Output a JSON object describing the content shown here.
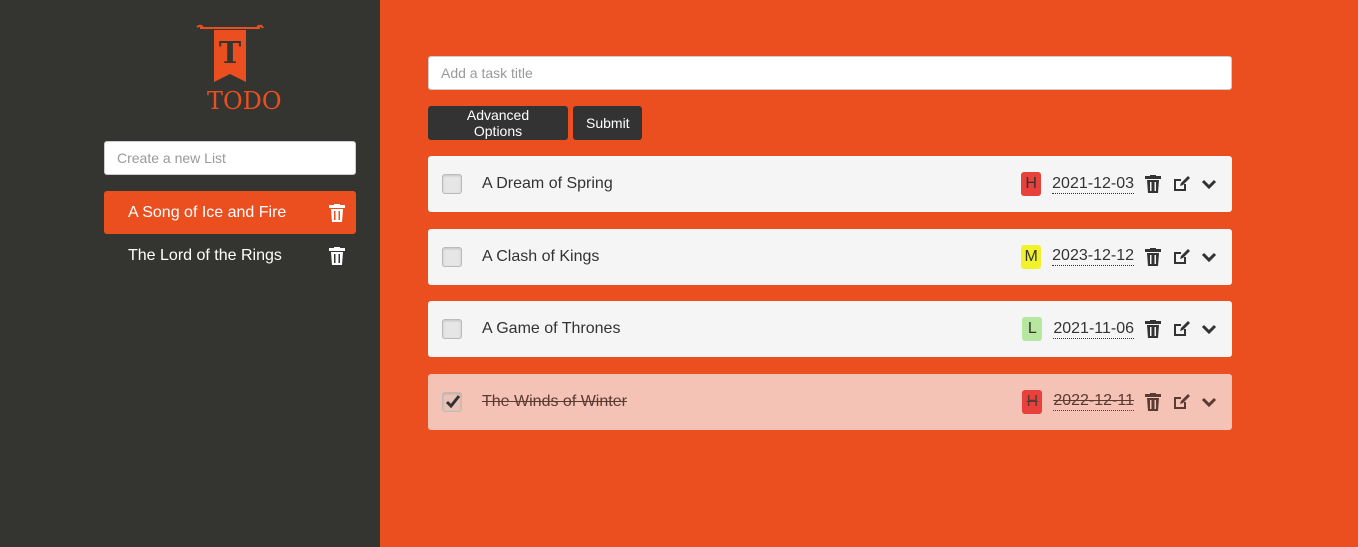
{
  "sidebar": {
    "logo_text": "TODO",
    "logo_letter": "T",
    "new_list_placeholder": "Create a new List",
    "lists": [
      {
        "label": "A Song of Ice and Fire",
        "active": true
      },
      {
        "label": "The Lord of the Rings",
        "active": false
      }
    ]
  },
  "main": {
    "task_placeholder": "Add a task title",
    "advanced_label": "Advanced Options",
    "submit_label": "Submit",
    "tasks": [
      {
        "title": "A Dream of Spring",
        "priority": "H",
        "priority_color": "#e8403a",
        "date": "2021-12-03",
        "done": false
      },
      {
        "title": "A Clash of Kings",
        "priority": "M",
        "priority_color": "#f2f22a",
        "date": "2023-12-12",
        "done": false
      },
      {
        "title": "A Game of Thrones",
        "priority": "L",
        "priority_color": "#b6e6a0",
        "date": "2021-11-06",
        "done": false
      },
      {
        "title": "The Winds of Winter",
        "priority": "H",
        "priority_color": "#e8403a",
        "date": "2022-12-11",
        "done": true
      }
    ]
  },
  "colors": {
    "accent": "#ec4f1f",
    "sidebar_bg": "#343431",
    "button_bg": "#333333",
    "done_bg": "#f4c3b5"
  },
  "icons": {
    "delete": "trash-icon",
    "edit": "edit-icon",
    "expand": "chevron-down-icon",
    "check": "checkmark-icon"
  }
}
